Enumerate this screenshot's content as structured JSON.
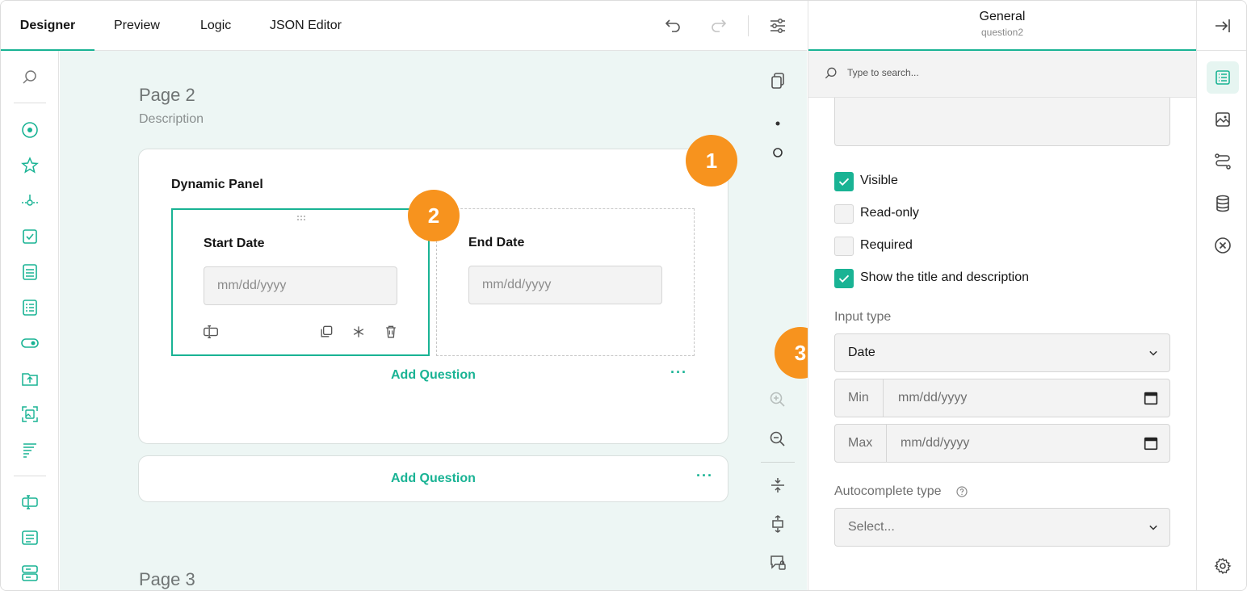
{
  "topbar": {
    "tabs": [
      {
        "label": "Designer",
        "active": true
      },
      {
        "label": "Preview"
      },
      {
        "label": "Logic"
      },
      {
        "label": "JSON Editor"
      }
    ],
    "icons": [
      "undo-icon",
      "redo-icon",
      "settings-sliders-icon"
    ]
  },
  "toolbox": {
    "icons": [
      "search-icon",
      "radiogroup-icon",
      "rating-icon",
      "slider-icon",
      "checkbox-icon",
      "dropdown-icon",
      "tagbox-icon",
      "boolean-icon",
      "file-upload-icon",
      "image-picker-icon",
      "ranking-icon",
      "text-input-icon",
      "comment-icon",
      "multiple-text-icon"
    ]
  },
  "canvas": {
    "page2": {
      "title": "Page 2",
      "description": "Description"
    },
    "panel": {
      "title": "Dynamic Panel",
      "questions": [
        {
          "title": "Start Date",
          "placeholder": "mm/dd/yyyy",
          "selected": true
        },
        {
          "title": "End Date",
          "placeholder": "mm/dd/yyyy",
          "selected": false
        }
      ],
      "add_question": "Add Question",
      "more": "···"
    },
    "add_question": "Add Question",
    "more": "···",
    "page3": {
      "title": "Page 3"
    }
  },
  "badges": [
    "1",
    "2",
    "3"
  ],
  "properties": {
    "title": "General",
    "subtitle": "question2",
    "search_placeholder": "Type to search...",
    "checkboxes": [
      {
        "label": "Visible",
        "checked": true
      },
      {
        "label": "Read-only",
        "checked": false
      },
      {
        "label": "Required",
        "checked": false
      },
      {
        "label": "Show the title and description",
        "checked": true
      }
    ],
    "input_type": {
      "label": "Input type",
      "value": "Date"
    },
    "min": {
      "label": "Min",
      "placeholder": "mm/dd/yyyy"
    },
    "max": {
      "label": "Max",
      "placeholder": "mm/dd/yyyy"
    },
    "autocomplete": {
      "label": "Autocomplete type",
      "placeholder": "Select..."
    }
  },
  "colors": {
    "accent": "#19b394",
    "badge": "#f7931e",
    "canvas_bg": "#edf6f4"
  }
}
